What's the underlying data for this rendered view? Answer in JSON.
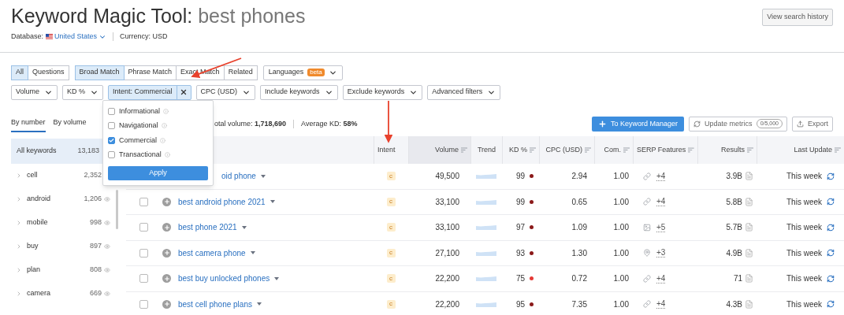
{
  "title": "Keyword Magic Tool:",
  "query": "best phones",
  "history_button": "View search history",
  "database": {
    "label": "Database:",
    "value": "United States",
    "currency": "Currency: USD"
  },
  "match_groups": [
    [
      {
        "label": "All",
        "selected": true
      },
      {
        "label": "Questions",
        "selected": false
      }
    ],
    [
      {
        "label": "Broad Match",
        "selected": true
      },
      {
        "label": "Phrase Match",
        "selected": false
      },
      {
        "label": "Exact Match",
        "selected": false
      },
      {
        "label": "Related",
        "selected": false
      }
    ]
  ],
  "languages": {
    "label": "Languages",
    "badge": "beta"
  },
  "filters": [
    {
      "label": "Volume",
      "kind": "dropdown"
    },
    {
      "label": "KD %",
      "kind": "dropdown"
    },
    {
      "label": "Intent: Commercial",
      "kind": "active"
    },
    {
      "label": "CPC (USD)",
      "kind": "dropdown"
    },
    {
      "label": "Include keywords",
      "kind": "dropdown"
    },
    {
      "label": "Exclude keywords",
      "kind": "dropdown"
    },
    {
      "label": "Advanced filters",
      "kind": "dropdown"
    }
  ],
  "intent_popup": {
    "options": [
      {
        "label": "Informational",
        "checked": false
      },
      {
        "label": "Navigational",
        "checked": false
      },
      {
        "label": "Commercial",
        "checked": true
      },
      {
        "label": "Transactional",
        "checked": false
      }
    ],
    "apply": "Apply"
  },
  "view_tabs": [
    {
      "label": "By number",
      "selected": true
    },
    {
      "label": "By volume",
      "selected": false
    }
  ],
  "summary": [
    {
      "label": "otal volume:",
      "value": "1,718,690"
    },
    {
      "label": "Average KD:",
      "value": "58%"
    }
  ],
  "actions": {
    "keyword_manager": "To Keyword Manager",
    "update": "Update metrics",
    "update_count": "0/5,000",
    "export": "Export"
  },
  "groups": {
    "header": {
      "label": "All keywords",
      "count": "13,183"
    },
    "items": [
      {
        "label": "cell",
        "count": "2,352",
        "eye": false
      },
      {
        "label": "android",
        "count": "1,206",
        "eye": true
      },
      {
        "label": "mobile",
        "count": "998",
        "eye": true
      },
      {
        "label": "buy",
        "count": "897",
        "eye": true
      },
      {
        "label": "plan",
        "count": "808",
        "eye": true
      },
      {
        "label": "camera",
        "count": "669",
        "eye": true
      }
    ]
  },
  "table": {
    "columns": [
      {
        "label": "Intent",
        "sortable": false,
        "selected": false
      },
      {
        "label": "Volume",
        "sortable": true,
        "selected": true
      },
      {
        "label": "Trend",
        "sortable": false,
        "selected": false
      },
      {
        "label": "KD %",
        "sortable": true,
        "selected": false
      },
      {
        "label": "CPC (USD)",
        "sortable": true,
        "selected": false
      },
      {
        "label": "Com.",
        "sortable": true,
        "selected": false
      },
      {
        "label": "SERP Features",
        "sortable": true,
        "selected": false
      },
      {
        "label": "Results",
        "sortable": true,
        "selected": false
      },
      {
        "label": "Last Update",
        "sortable": true,
        "selected": false
      }
    ],
    "rows": [
      {
        "kind": "covered",
        "keyword": "oid phone",
        "intent": "c",
        "volume": "49,500",
        "kd": "99",
        "color": "#8b1a1a",
        "cpc": "2.94",
        "com": "1.00",
        "serp": {
          "kind": "link",
          "more": "+4"
        },
        "results": "3.9B",
        "updated": "This week"
      },
      {
        "kind": "row",
        "checked": false,
        "keyword": "best android phone 2021",
        "intent": "c",
        "volume": "33,100",
        "kd": "99",
        "color": "#8b1a1a",
        "cpc": "0.65",
        "com": "1.00",
        "serp": {
          "kind": "link",
          "more": "+4"
        },
        "results": "5.8B",
        "updated": "This week"
      },
      {
        "kind": "row",
        "checked": false,
        "keyword": "best phone 2021",
        "intent": "c",
        "volume": "33,100",
        "kd": "97",
        "color": "#8b1a1a",
        "cpc": "1.09",
        "com": "1.00",
        "serp": {
          "kind": "image",
          "more": "+5"
        },
        "results": "5.7B",
        "updated": "This week"
      },
      {
        "kind": "row",
        "checked": false,
        "keyword": "best camera phone",
        "intent": "c",
        "volume": "27,100",
        "kd": "93",
        "color": "#8b1a1a",
        "cpc": "1.30",
        "com": "1.00",
        "serp": {
          "kind": "pin",
          "more": "+3"
        },
        "results": "4.9B",
        "updated": "This week"
      },
      {
        "kind": "row",
        "checked": false,
        "keyword": "best buy unlocked phones",
        "intent": "c",
        "volume": "22,200",
        "kd": "75",
        "color": "#e53935",
        "cpc": "0.72",
        "com": "1.00",
        "serp": {
          "kind": "link",
          "more": "+4"
        },
        "results": "71",
        "updated": "This week"
      },
      {
        "kind": "row",
        "checked": false,
        "keyword": "best cell phone plans",
        "intent": "c",
        "volume": "22,200",
        "kd": "95",
        "color": "#8b1a1a",
        "cpc": "7.35",
        "com": "1.00",
        "serp": {
          "kind": "link",
          "more": "+4"
        },
        "results": "4.3B",
        "updated": "This week"
      }
    ]
  }
}
